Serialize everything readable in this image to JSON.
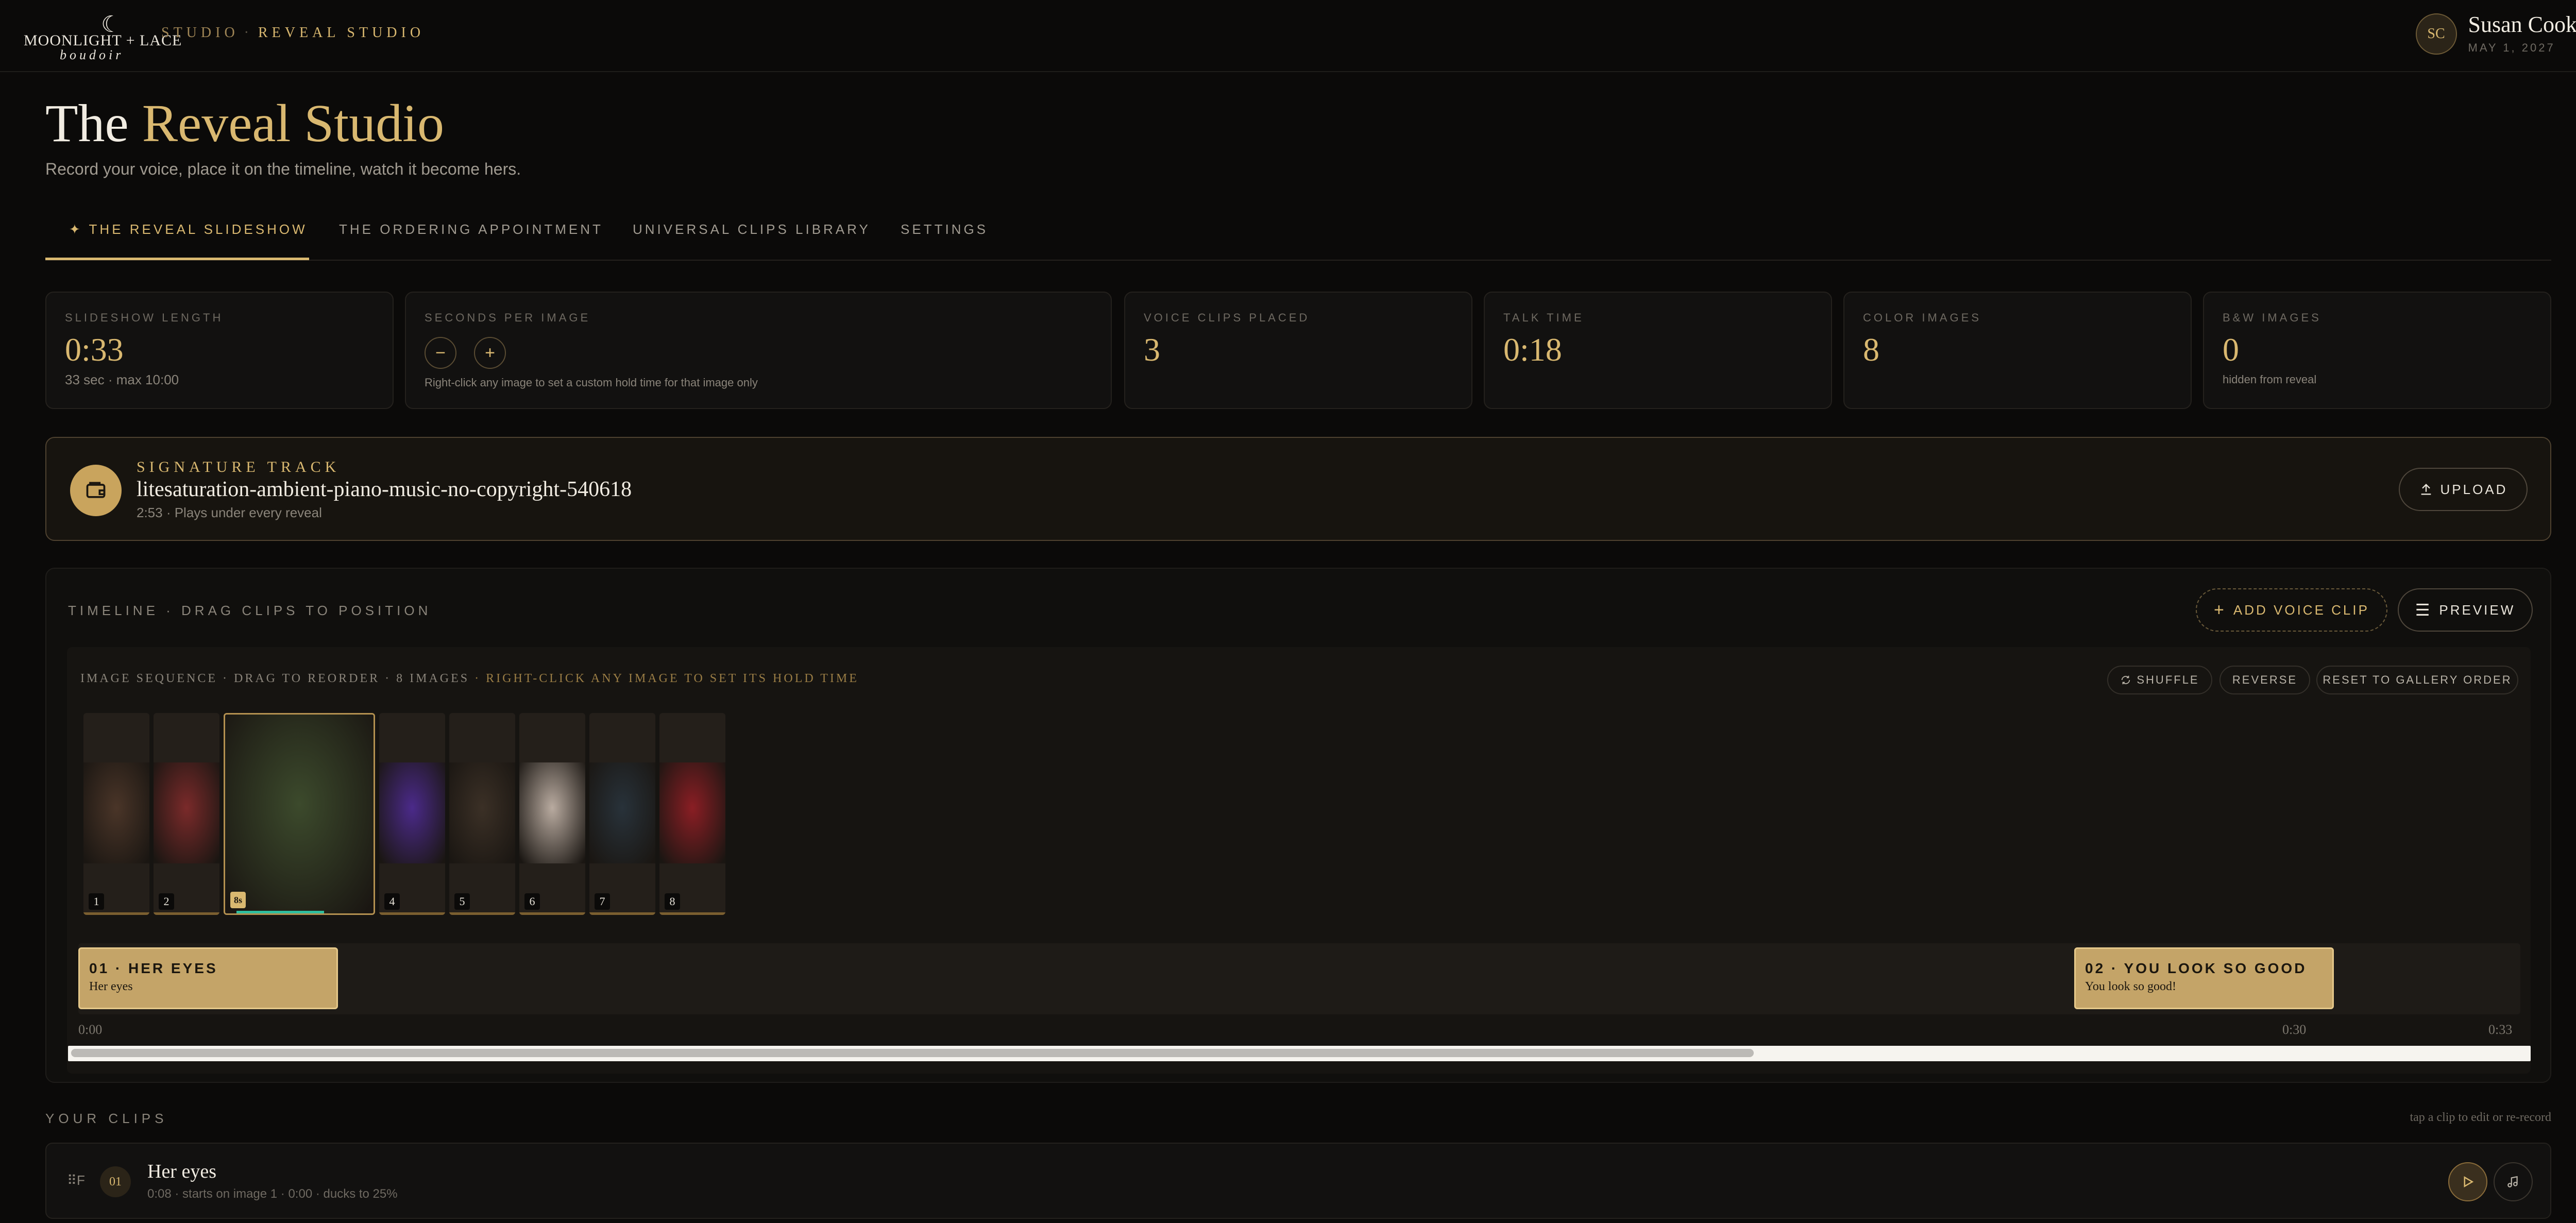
{
  "header": {
    "brand_top": "MOONLIGHT + LACE",
    "brand_script": "boudoir",
    "crumb_studio": "STUDIO",
    "crumb_sep": "·",
    "crumb_current": "REVEAL STUDIO",
    "user_initials": "SC",
    "user_name": "Susan Cook",
    "user_date": "MAY 1, 2027"
  },
  "page": {
    "title_plain": "The",
    "title_accent": "Reveal Studio",
    "subtitle": "Record your voice, place it on the timeline, watch it become hers."
  },
  "tabs": [
    {
      "label": "✦ THE REVEAL SLIDESHOW",
      "active": true
    },
    {
      "label": "THE ORDERING APPOINTMENT",
      "active": false
    },
    {
      "label": "UNIVERSAL CLIPS LIBRARY",
      "active": false
    },
    {
      "label": "SETTINGS",
      "active": false
    }
  ],
  "stats": {
    "length_label": "SLIDESHOW LENGTH",
    "length_value": "0:33",
    "length_note": "33 sec · max 10:00",
    "spi_label": "SECONDS PER IMAGE",
    "spi_minus": "−",
    "spi_plus": "+",
    "spi_note": "Right-click any image to set a custom hold time for that image only",
    "voice_label": "VOICE CLIPS PLACED",
    "voice_value": "3",
    "talk_label": "TALK TIME",
    "talk_value": "0:18",
    "color_label": "COLOR IMAGES",
    "color_value": "8",
    "bw_label": "B&W IMAGES",
    "bw_value": "0",
    "bw_note": "hidden from reveal"
  },
  "signature": {
    "label": "SIGNATURE TRACK",
    "name": "litesaturation-ambient-piano-music-no-copyright-540618",
    "meta": "2:53 · Plays under every reveal",
    "upload_label": "UPLOAD"
  },
  "timeline": {
    "heading": "TIMELINE · DRAG CLIPS TO POSITION",
    "add_clip_label": "ADD VOICE CLIP",
    "preview_label": "PREVIEW",
    "seq_heading": "IMAGE SEQUENCE · DRAG TO REORDER · 8 IMAGES",
    "seq_hint": " · RIGHT-CLICK ANY IMAGE TO SET ITS HOLD TIME",
    "shuffle_label": "SHUFFLE",
    "reverse_label": "REVERSE",
    "reset_label": "RESET TO GALLERY ORDER",
    "images": [
      {
        "num": "1",
        "tone": "#4a3528"
      },
      {
        "num": "2",
        "tone": "#7a2a2a"
      },
      {
        "num": "8s",
        "tone": "#3c4a2c"
      },
      {
        "num": "4",
        "tone": "#4b2a8a"
      },
      {
        "num": "5",
        "tone": "#3b3026"
      },
      {
        "num": "6",
        "tone": "#b9aba0"
      },
      {
        "num": "7",
        "tone": "#28323a"
      },
      {
        "num": "8",
        "tone": "#8a1e24"
      }
    ],
    "clips": [
      {
        "title": "01 · HER EYES",
        "subtitle": "Her eyes"
      },
      {
        "title": "02 · YOU LOOK SO GOOD",
        "subtitle": "You look so good!"
      }
    ],
    "ticks": [
      "0:00",
      "0:30",
      "0:33"
    ]
  },
  "your_clips": {
    "heading": "YOUR CLIPS",
    "hint": "tap a clip to edit or re-record",
    "items": [
      {
        "drag": "⠿F",
        "index": "01",
        "name": "Her eyes",
        "meta": "0:08 · starts on image 1 · 0:00 · ducks to 25%"
      }
    ]
  },
  "colors": {
    "accent": "#d9b870",
    "background": "#0b0a09",
    "clip": "#c4a468",
    "selected_progress": "#2fbf9f"
  }
}
